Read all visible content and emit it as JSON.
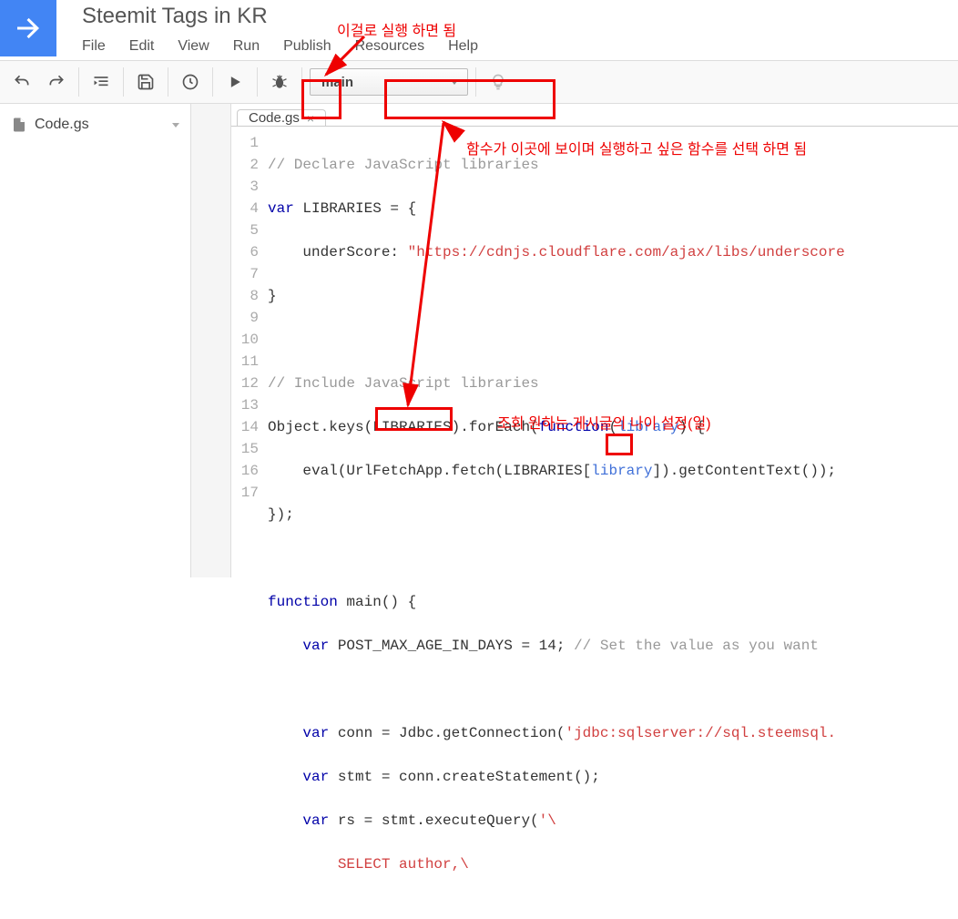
{
  "project_title": "Steemit Tags in KR",
  "menu": {
    "file": "File",
    "edit": "Edit",
    "view": "View",
    "run": "Run",
    "publish": "Publish",
    "resources": "Resources",
    "help": "Help"
  },
  "function_selector": "main",
  "sidebar": {
    "file": "Code.gs"
  },
  "tab": {
    "label": "Code.gs"
  },
  "annotations": {
    "run_hint": "이걸로 실행 하면 됨",
    "selector_hint": "함수가 이곳에 보이며 실행하고 싶은 함수를 선택 하면 됨",
    "age_hint": "조회 원하는 게시글의 나이 설정(일)"
  },
  "code": {
    "l1_a": "// Declare JavaScript libraries",
    "l2_a": "var",
    "l2_b": " LIBRARIES = {",
    "l3_a": "    underScore: ",
    "l3_b": "\"https://cdnjs.cloudflare.com/ajax/libs/underscore",
    "l4_a": "}",
    "l5_a": "",
    "l6_a": "// Include JavaScript libraries",
    "l7_a": "Object.keys(LIBRARIES).forEach(",
    "l7_b": "function",
    "l7_c": "(",
    "l7_d": "library",
    "l7_e": ") {",
    "l8_a": "    eval(UrlFetchApp.fetch(LIBRARIES[",
    "l8_b": "library",
    "l8_c": "]).getContentText());",
    "l9_a": "});",
    "l10_a": "",
    "l11_a": "function",
    "l11_b": " main",
    "l11_c": "() {",
    "l12_a": "    ",
    "l12_b": "var",
    "l12_c": " POST_MAX_AGE_IN_DAYS = ",
    "l12_d": "14",
    "l12_e": "; ",
    "l12_f": "// Set the value as you want",
    "l13_a": "",
    "l14_a": "    ",
    "l14_b": "var",
    "l14_c": " conn = Jdbc.getConnection(",
    "l14_d": "'jdbc:sqlserver://sql.steemsql.",
    "l15_a": "    ",
    "l15_b": "var",
    "l15_c": " stmt = conn.createStatement();",
    "l16_a": "    ",
    "l16_b": "var",
    "l16_c": " rs = stmt.executeQuery(",
    "l16_d": "'\\",
    "l17_a": "        SELECT author,\\"
  }
}
